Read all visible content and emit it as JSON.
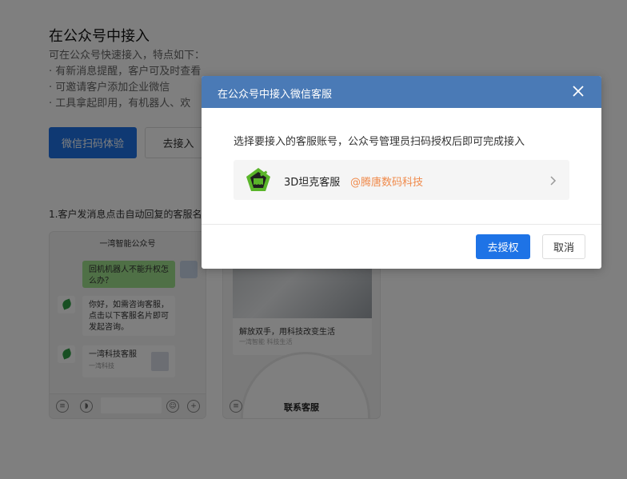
{
  "page": {
    "title": "在公众号中接入",
    "desc": "可在公众号快速接入，特点如下：",
    "features": [
      "· 有新消息提醒，客户可及时查看",
      "· 可邀请客户添加企业微信",
      "· 工具拿起即用，有机器人、欢"
    ],
    "btn_try": "微信扫码体验",
    "btn_connect": "去接入",
    "step1": "1.客户发消息点击自动回复的客服名"
  },
  "phone1": {
    "title": "一湾智能公众号",
    "msg_user": "回机机器人不能升权怎么办？",
    "msg_bot": "你好，如需咨询客服，点击以下客服名片即可发起咨询。",
    "card_name": "一湾科技客服",
    "card_sub": "一湾科技"
  },
  "phone2": {
    "headline": "解放双手，用科技改变生活",
    "subline": "一湾智能 科技生活",
    "contact": "联系客服"
  },
  "modal": {
    "title": "在公众号中接入微信客服",
    "text": "选择要接入的客服账号，公众号管理员扫码授权后即可完成接入",
    "account_name": "3D坦克客服",
    "account_org": "@腾唐数码科技",
    "btn_authorize": "去授权",
    "btn_cancel": "取消",
    "icons": {
      "close": "close-icon",
      "arrow": "chevron-right-icon",
      "logo": "tank-logo-icon"
    }
  },
  "colors": {
    "primary": "#1e73e6",
    "header": "#4a7ab6",
    "org": "#f08a4b",
    "logo": "#5ab52a"
  }
}
